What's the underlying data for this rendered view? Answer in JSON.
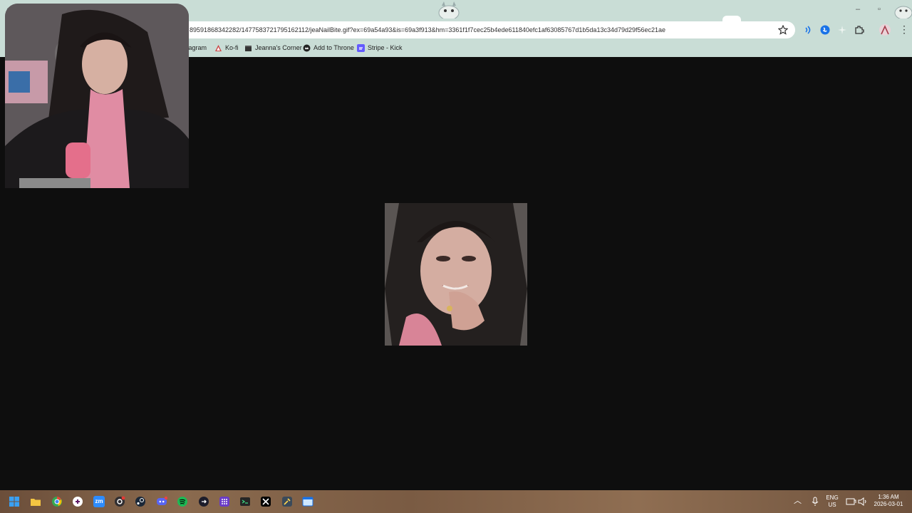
{
  "browser": {
    "url": "89591868342282/1477583721795162112/jeaNailBite.gif?ex=69a54a93&is=69a3f913&hm=3361f1f7cec25b4ede611840efc1af63085767d1b5da13c34d79d29f56ec21ae",
    "bookmarks": [
      {
        "label": "tagram",
        "icon": "instagram-icon"
      },
      {
        "label": "Ko-fi",
        "icon": "kofi-icon"
      },
      {
        "label": "Jeanna's Corner",
        "icon": "box-icon"
      },
      {
        "label": "Add to Throne",
        "icon": "throne-icon"
      },
      {
        "label": "Stripe - Kick",
        "icon": "stripe-icon"
      }
    ],
    "accent_color": "#c9ddd6"
  },
  "content": {
    "background_color": "#0e0e0e"
  },
  "taskbar": {
    "language_line1": "ENG",
    "language_line2": "US",
    "time": "1:36 AM",
    "date": "2026-03-01",
    "apps": [
      "start-icon",
      "file-explorer-icon",
      "chrome-icon",
      "slack-icon",
      "zoom-icon",
      "obs-icon",
      "steam-icon",
      "discord-icon",
      "spotify-icon",
      "cursor-icon",
      "grid-app-icon",
      "terminal-icon",
      "capcut-icon",
      "tool-icon",
      "window-app-icon"
    ],
    "zoom_label": "zm"
  }
}
